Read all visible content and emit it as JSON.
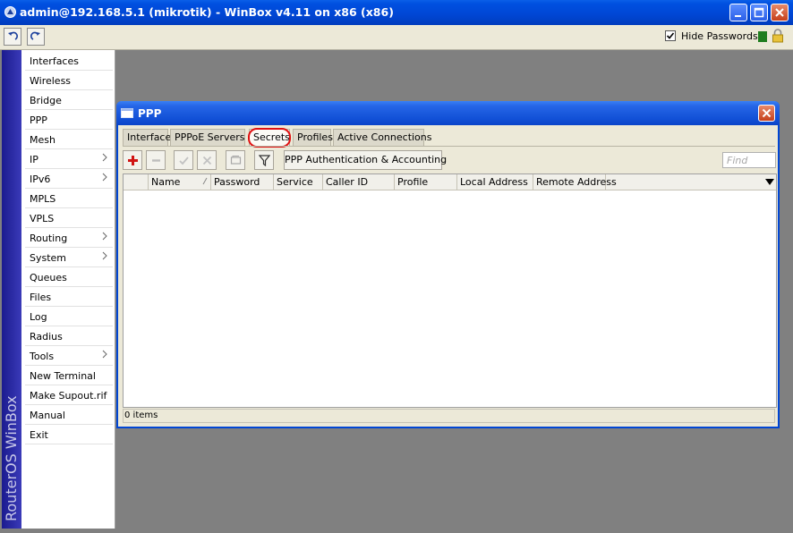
{
  "window": {
    "title": "admin@192.168.5.1 (mikrotik) - WinBox v4.11 on x86 (x86)"
  },
  "toolbar": {
    "undo_icon": "undo-icon",
    "redo_icon": "redo-icon",
    "hide_passwords_label": "Hide Passwords",
    "hide_passwords_checked": true
  },
  "sidebar": {
    "brand": "RouterOS WinBox",
    "items": [
      {
        "label": "Interfaces",
        "submenu": false
      },
      {
        "label": "Wireless",
        "submenu": false
      },
      {
        "label": "Bridge",
        "submenu": false
      },
      {
        "label": "PPP",
        "submenu": false
      },
      {
        "label": "Mesh",
        "submenu": false
      },
      {
        "label": "IP",
        "submenu": true
      },
      {
        "label": "IPv6",
        "submenu": true
      },
      {
        "label": "MPLS",
        "submenu": false
      },
      {
        "label": "VPLS",
        "submenu": false
      },
      {
        "label": "Routing",
        "submenu": true
      },
      {
        "label": "System",
        "submenu": true
      },
      {
        "label": "Queues",
        "submenu": false
      },
      {
        "label": "Files",
        "submenu": false
      },
      {
        "label": "Log",
        "submenu": false
      },
      {
        "label": "Radius",
        "submenu": false
      },
      {
        "label": "Tools",
        "submenu": true
      },
      {
        "label": "New Terminal",
        "submenu": false
      },
      {
        "label": "Make Supout.rif",
        "submenu": false
      },
      {
        "label": "Manual",
        "submenu": false
      },
      {
        "label": "Exit",
        "submenu": false
      }
    ]
  },
  "ppp": {
    "title": "PPP",
    "tabs": [
      {
        "label": "Interface",
        "active": false
      },
      {
        "label": "PPPoE Servers",
        "active": false
      },
      {
        "label": "Secrets",
        "active": true
      },
      {
        "label": "Profiles",
        "active": false
      },
      {
        "label": "Active Connections",
        "active": false
      }
    ],
    "auth_button": "PPP Authentication & Accounting",
    "find_placeholder": "Find",
    "columns": [
      "Name",
      "Password",
      "Service",
      "Caller ID",
      "Profile",
      "Local Address",
      "Remote Address"
    ],
    "rows": [],
    "status": "0 items"
  },
  "colors": {
    "titlebar": "#0046d4",
    "window_bg": "#ece9d8",
    "sidebar_strip": "#1b1b8f",
    "highlight_ring": "#e01010"
  }
}
